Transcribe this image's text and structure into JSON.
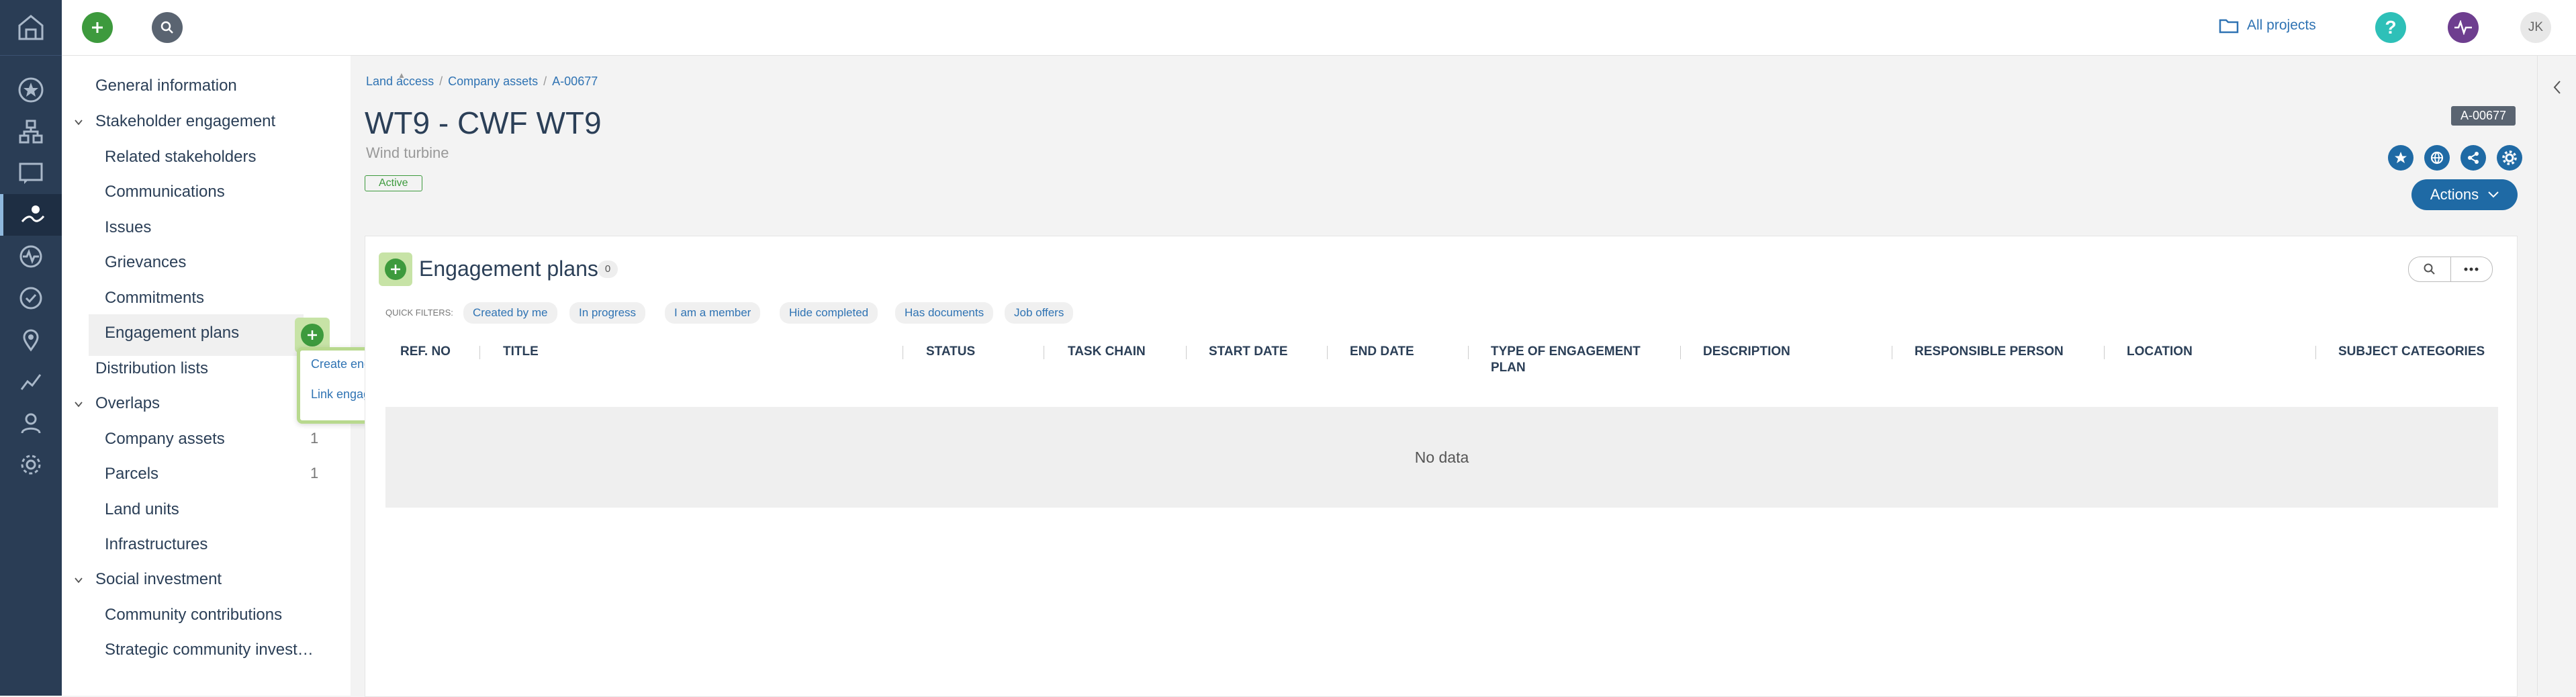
{
  "topbar": {
    "all_projects": "All projects",
    "help": "?",
    "avatar": "JK"
  },
  "sidebar": {
    "items": [
      {
        "label": "General information",
        "level": 0
      },
      {
        "label": "Stakeholder engagement",
        "level": 0,
        "expanded": true
      },
      {
        "label": "Related stakeholders",
        "level": 1
      },
      {
        "label": "Communications",
        "level": 1
      },
      {
        "label": "Issues",
        "level": 1
      },
      {
        "label": "Grievances",
        "level": 1
      },
      {
        "label": "Commitments",
        "level": 1
      },
      {
        "label": "Engagement plans",
        "level": 1,
        "selected": true
      },
      {
        "label": "Distribution lists",
        "level": 0
      },
      {
        "label": "Overlaps",
        "level": 0,
        "expanded": true
      },
      {
        "label": "Company assets",
        "level": 1,
        "count": "1"
      },
      {
        "label": "Parcels",
        "level": 1,
        "count": "1"
      },
      {
        "label": "Land units",
        "level": 1
      },
      {
        "label": "Infrastructures",
        "level": 1
      },
      {
        "label": "Social investment",
        "level": 0,
        "expanded": true
      },
      {
        "label": "Community contributions",
        "level": 1
      },
      {
        "label": "Strategic community invest…",
        "level": 1
      }
    ],
    "dropdown": {
      "create": "Create engagement plan",
      "link": "Link engagement plan"
    }
  },
  "breadcrumb": {
    "b1": "Land access",
    "b2": "Company assets",
    "b3": "A-00677",
    "sep": "/"
  },
  "record": {
    "title": "WT9 - CWF WT9",
    "subtitle": "Wind turbine",
    "status": "Active",
    "id": "A-00677",
    "actions": "Actions"
  },
  "panel": {
    "title": "Engagement plans",
    "count": "0",
    "quick_filters_label": "QUICK FILTERS:",
    "quick_filters": [
      "Created by me",
      "In progress",
      "I am a member",
      "Hide completed",
      "Has documents",
      "Job offers"
    ],
    "columns": [
      "REF. NO",
      "TITLE",
      "STATUS",
      "TASK CHAIN",
      "START DATE",
      "END DATE",
      "TYPE OF ENGAGEMENT PLAN",
      "DESCRIPTION",
      "RESPONSIBLE PERSON",
      "LOCATION",
      "SUBJECT CATEGORIES"
    ],
    "empty": "No data"
  },
  "colors": {
    "rail": "#2a3d55",
    "primary": "#1f6aa5",
    "green": "#3d9a3d",
    "highlight": "#c7e3a6"
  }
}
